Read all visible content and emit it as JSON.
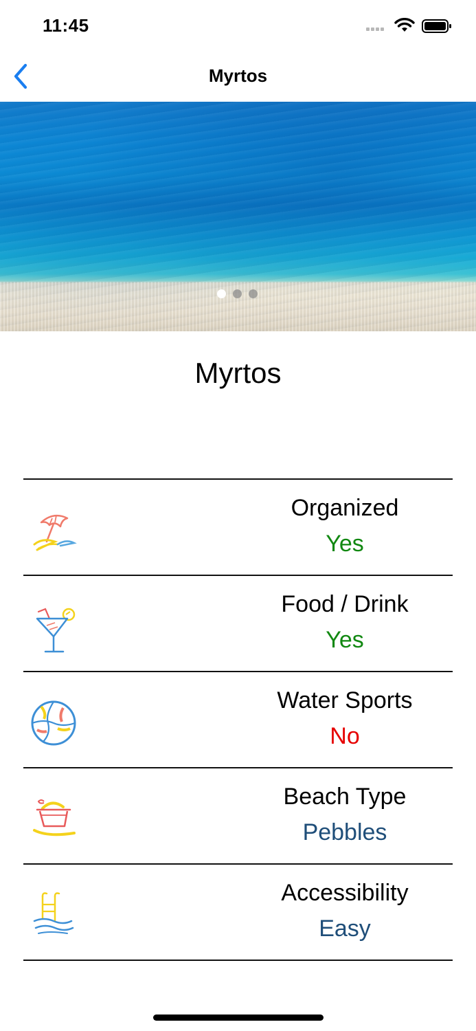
{
  "status_bar": {
    "time": "11:45",
    "wifi_icon": "wifi-icon",
    "battery_icon": "battery-icon"
  },
  "nav": {
    "title": "Myrtos",
    "back_icon": "chevron-left-icon",
    "accent_color": "#1a7ef0"
  },
  "hero": {
    "page_count": 3,
    "current_page": 1
  },
  "beach": {
    "name": "Myrtos"
  },
  "features": [
    {
      "icon": "umbrella-icon",
      "label": "Organized",
      "value": "Yes",
      "status": "yes"
    },
    {
      "icon": "cocktail-icon",
      "label": "Food / Drink",
      "value": "Yes",
      "status": "yes"
    },
    {
      "icon": "beach-ball-icon",
      "label": "Water Sports",
      "value": "No",
      "status": "no"
    },
    {
      "icon": "sand-bucket-icon",
      "label": "Beach Type",
      "value": "Pebbles",
      "status": "info"
    },
    {
      "icon": "pool-ladder-icon",
      "label": "Accessibility",
      "value": "Easy",
      "status": "info"
    }
  ],
  "colors": {
    "yes": "#118811",
    "no": "#e60000",
    "info": "#1f4e79"
  }
}
